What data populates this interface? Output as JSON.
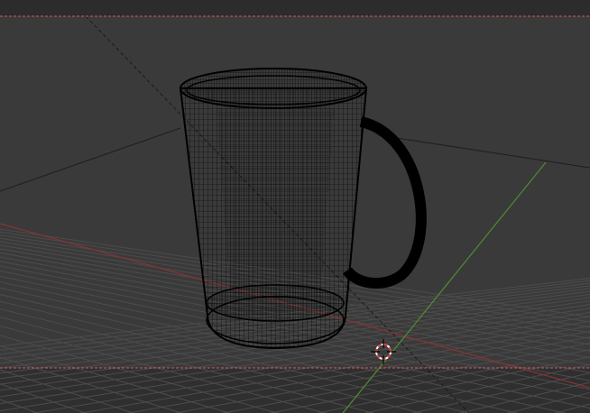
{
  "viewport": {
    "view": "perspective",
    "shading": "wireframe",
    "background_color": "#3a3a3a",
    "object_outside_camera_color": "#2e2e2e",
    "camera_border_color": "#d45a5a",
    "grid_color": "#4a4a4a",
    "x_axis_color": "#8a3232",
    "y_axis_color": "#4f8c32",
    "wire_color": "#000000"
  },
  "scene": {
    "object_name_icon": "mug-wireframe",
    "cursor_icon": "3d-cursor-icon"
  }
}
